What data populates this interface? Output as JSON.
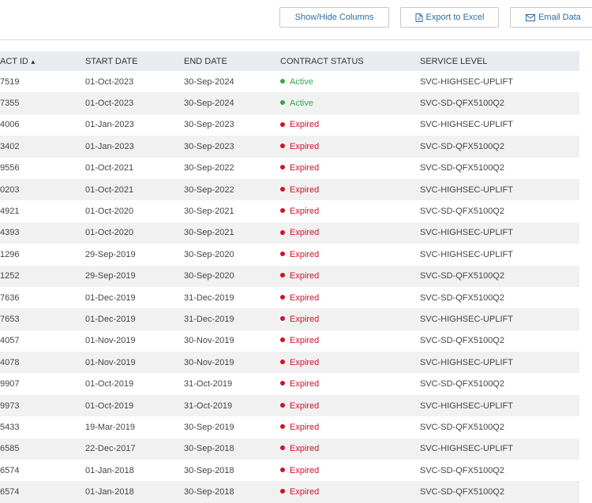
{
  "toolbar": {
    "show_hide_label": "Show/Hide Columns",
    "export_label": "Export to Excel",
    "email_label": "Email Data"
  },
  "colors": {
    "active": "#3aa64a",
    "expired": "#d0112b",
    "link": "#2d6da3"
  },
  "table": {
    "headers": {
      "id": "ACT ID",
      "start": "START DATE",
      "end": "END DATE",
      "status": "CONTRACT STATUS",
      "service": "SERVICE LEVEL"
    },
    "rows": [
      {
        "id": "7519",
        "start": "01-Oct-2023",
        "end": "30-Sep-2024",
        "status": "Active",
        "service": "SVC-HIGHSEC-UPLIFT"
      },
      {
        "id": "7355",
        "start": "01-Oct-2023",
        "end": "30-Sep-2024",
        "status": "Active",
        "service": "SVC-SD-QFX5100Q2"
      },
      {
        "id": "4006",
        "start": "01-Jan-2023",
        "end": "30-Sep-2023",
        "status": "Expired",
        "service": "SVC-HIGHSEC-UPLIFT"
      },
      {
        "id": "3402",
        "start": "01-Jan-2023",
        "end": "30-Sep-2023",
        "status": "Expired",
        "service": "SVC-SD-QFX5100Q2"
      },
      {
        "id": "9556",
        "start": "01-Oct-2021",
        "end": "30-Sep-2022",
        "status": "Expired",
        "service": "SVC-SD-QFX5100Q2"
      },
      {
        "id": "0203",
        "start": "01-Oct-2021",
        "end": "30-Sep-2022",
        "status": "Expired",
        "service": "SVC-HIGHSEC-UPLIFT"
      },
      {
        "id": "4921",
        "start": "01-Oct-2020",
        "end": "30-Sep-2021",
        "status": "Expired",
        "service": "SVC-SD-QFX5100Q2"
      },
      {
        "id": "4393",
        "start": "01-Oct-2020",
        "end": "30-Sep-2021",
        "status": "Expired",
        "service": "SVC-HIGHSEC-UPLIFT"
      },
      {
        "id": "1296",
        "start": "29-Sep-2019",
        "end": "30-Sep-2020",
        "status": "Expired",
        "service": "SVC-HIGHSEC-UPLIFT"
      },
      {
        "id": "1252",
        "start": "29-Sep-2019",
        "end": "30-Sep-2020",
        "status": "Expired",
        "service": "SVC-SD-QFX5100Q2"
      },
      {
        "id": "7636",
        "start": "01-Dec-2019",
        "end": "31-Dec-2019",
        "status": "Expired",
        "service": "SVC-SD-QFX5100Q2"
      },
      {
        "id": "7653",
        "start": "01-Dec-2019",
        "end": "31-Dec-2019",
        "status": "Expired",
        "service": "SVC-HIGHSEC-UPLIFT"
      },
      {
        "id": "4057",
        "start": "01-Nov-2019",
        "end": "30-Nov-2019",
        "status": "Expired",
        "service": "SVC-SD-QFX5100Q2"
      },
      {
        "id": "4078",
        "start": "01-Nov-2019",
        "end": "30-Nov-2019",
        "status": "Expired",
        "service": "SVC-HIGHSEC-UPLIFT"
      },
      {
        "id": "9907",
        "start": "01-Oct-2019",
        "end": "31-Oct-2019",
        "status": "Expired",
        "service": "SVC-SD-QFX5100Q2"
      },
      {
        "id": "9973",
        "start": "01-Oct-2019",
        "end": "31-Oct-2019",
        "status": "Expired",
        "service": "SVC-HIGHSEC-UPLIFT"
      },
      {
        "id": "5433",
        "start": "19-Mar-2019",
        "end": "30-Sep-2019",
        "status": "Expired",
        "service": "SVC-SD-QFX5100Q2"
      },
      {
        "id": "6585",
        "start": "22-Dec-2017",
        "end": "30-Sep-2018",
        "status": "Expired",
        "service": "SVC-HIGHSEC-UPLIFT"
      },
      {
        "id": "6574",
        "start": "01-Jan-2018",
        "end": "30-Sep-2018",
        "status": "Expired",
        "service": "SVC-SD-QFX5100Q2"
      },
      {
        "id": "6574",
        "start": "01-Jan-2018",
        "end": "30-Sep-2018",
        "status": "Expired",
        "service": "SVC-SD-QFX5100Q2"
      }
    ]
  }
}
